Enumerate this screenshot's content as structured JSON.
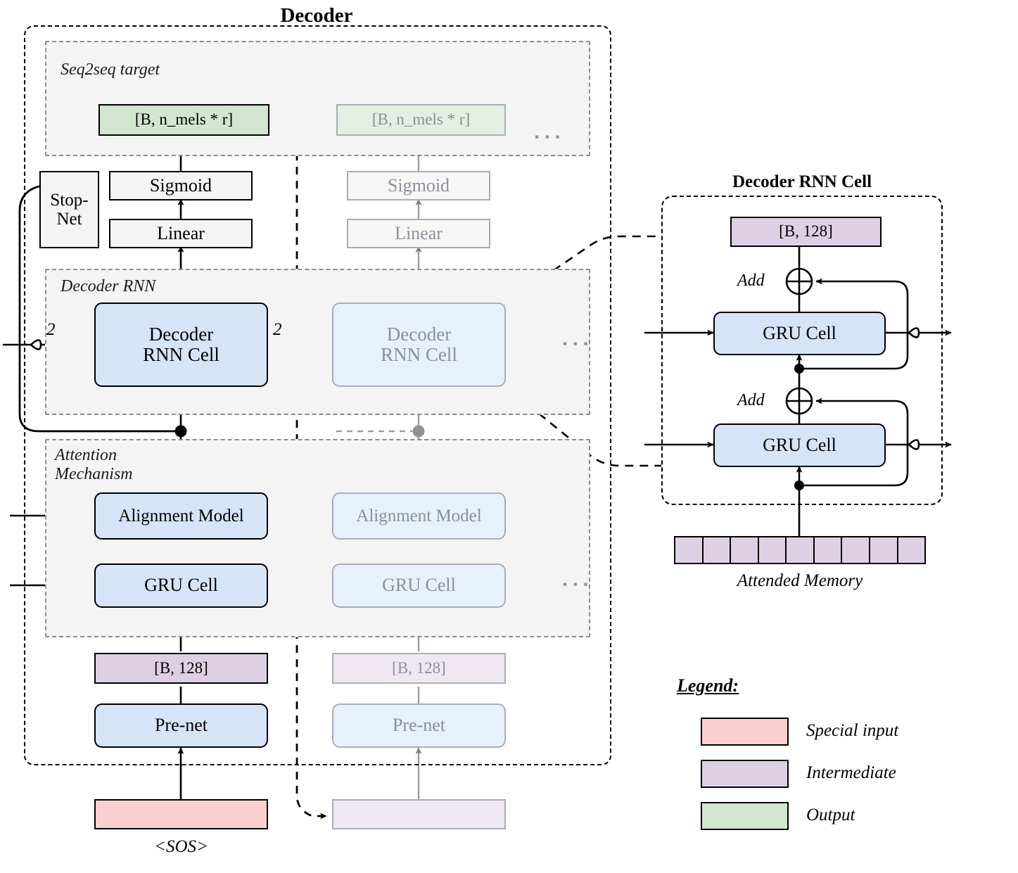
{
  "titles": {
    "decoder": "Decoder",
    "decoder_rnn_cell": "Decoder RNN Cell"
  },
  "regions": {
    "seq2seq_target": "Seq2seq target",
    "decoder_rnn": "Decoder RNN",
    "attention_mechanism": "Attention\nMechanism"
  },
  "step_current": {
    "output_box": "[B, n_mels * r]",
    "sigmoid": "Sigmoid",
    "linear": "Linear",
    "stop_net": "Stop-\nNet",
    "decoder_rnn_cell": "Decoder\nRNN Cell",
    "alignment_model": "Alignment Model",
    "gru_cell": "GRU Cell",
    "intermediate": "[B, 128]",
    "prenet": "Pre-net",
    "special_input": "",
    "special_input_caption": "<SOS>",
    "bus_label_in": "2",
    "bus_label_out": "2"
  },
  "step_next": {
    "output_box": "[B, n_mels * r]",
    "sigmoid": "Sigmoid",
    "linear": "Linear",
    "decoder_rnn_cell": "Decoder\nRNN Cell",
    "alignment_model": "Alignment Model",
    "gru_cell": "GRU Cell",
    "intermediate": "[B, 128]",
    "prenet": "Pre-net",
    "fed_input": ""
  },
  "ellipsis": {
    "rnn": "▪ ▪ ▪",
    "gru": "▪ ▪ ▪",
    "target": "▪ ▪ ▪"
  },
  "detail_panel": {
    "output": "[B, 128]",
    "add_top": "Add",
    "add_bottom": "Add",
    "gru_top": "GRU Cell",
    "gru_bottom": "GRU Cell",
    "attended_memory_caption": "Attended Memory",
    "memory_cells": 9
  },
  "legend": {
    "title": "Legend:",
    "items": [
      {
        "label": "Special input",
        "color": "#fbd0d0"
      },
      {
        "label": "Intermediate",
        "color": "#ded0e4"
      },
      {
        "label": "Output",
        "color": "#d3e6d0"
      }
    ]
  },
  "colors": {
    "blue": "#d6e4f7",
    "blue_faded": "#e8f0fb",
    "green": "#d3e6d0",
    "green_faded": "#e4eee2",
    "purple": "#ded0e4",
    "purple_faded": "#efe8f1",
    "pink": "#fbd0d0",
    "plain": "#f4f4f4",
    "stroke": "#000000",
    "stroke_faded": "#8e8e8e",
    "region_fill": "#f4f4f4"
  }
}
